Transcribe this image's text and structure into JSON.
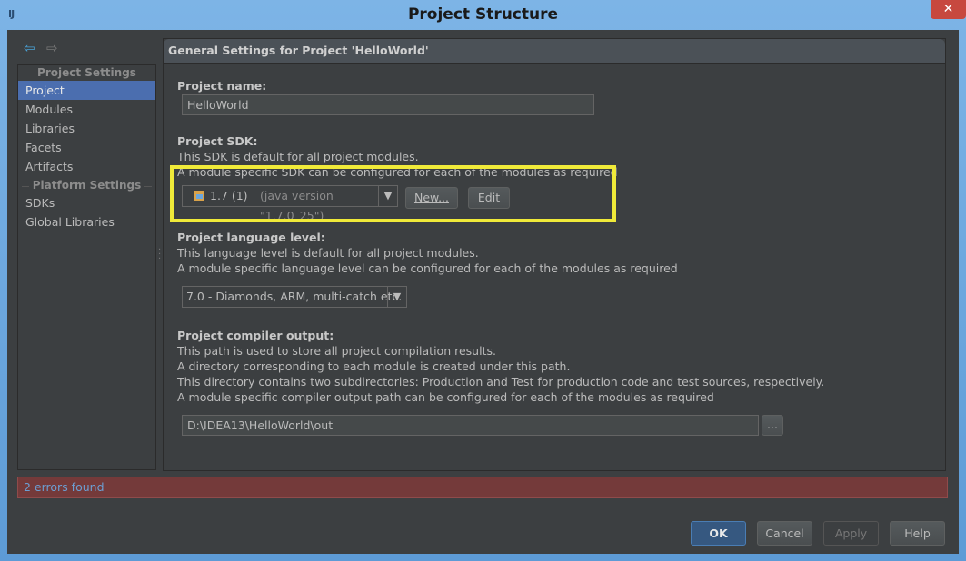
{
  "window": {
    "title": "Project Structure",
    "app_icon": "IJ",
    "close_glyph": "✕"
  },
  "nav": {
    "back_icon": "arrow-left-icon",
    "forward_icon": "arrow-right-icon",
    "back_glyph": "⇦",
    "forward_glyph": "⇨"
  },
  "sidebar": {
    "project_settings_header": "Project Settings",
    "project_items": [
      {
        "label": "Project",
        "selected": true
      },
      {
        "label": "Modules",
        "selected": false
      },
      {
        "label": "Libraries",
        "selected": false
      },
      {
        "label": "Facets",
        "selected": false
      },
      {
        "label": "Artifacts",
        "selected": false
      }
    ],
    "platform_settings_header": "Platform Settings",
    "platform_items": [
      {
        "label": "SDKs"
      },
      {
        "label": "Global Libraries"
      }
    ]
  },
  "panel": {
    "title": "General Settings for Project 'HelloWorld'",
    "project_name": {
      "label": "Project name:",
      "value": "HelloWorld"
    },
    "sdk": {
      "label": "Project SDK:",
      "desc1": "This SDK is default for all project modules.",
      "desc2": "A module specific SDK can be configured for each of the modules as required",
      "selected_name": "1.7 (1)",
      "selected_detail": "(java version \"1.7.0_25\")",
      "new_button": "New...",
      "edit_button": "Edit",
      "highlight_color": "#f0ea39"
    },
    "language_level": {
      "label": "Project language level:",
      "desc1": "This language level is default for all project modules.",
      "desc2": "A module specific language level can be configured for each of the modules as required",
      "selected": "7.0 - Diamonds, ARM, multi-catch etc."
    },
    "compiler_output": {
      "label": "Project compiler output:",
      "desc1": "This path is used to store all project compilation results.",
      "desc2": "A directory corresponding to each module is created under this path.",
      "desc3": "This directory contains two subdirectories: Production and Test for production code and test sources, respectively.",
      "desc4": "A module specific compiler output path can be configured for each of the modules as required",
      "path": "D:\\IDEA13\\HelloWorld\\out",
      "browse_label": "..."
    }
  },
  "status": {
    "errors": "2 errors found"
  },
  "buttons": {
    "ok": "OK",
    "cancel": "Cancel",
    "apply": "Apply",
    "help": "Help"
  },
  "colors": {
    "background": "#3c3f41",
    "selection": "#4b6eaf",
    "error_bg": "#743a3a",
    "ok_button": "#365880"
  }
}
